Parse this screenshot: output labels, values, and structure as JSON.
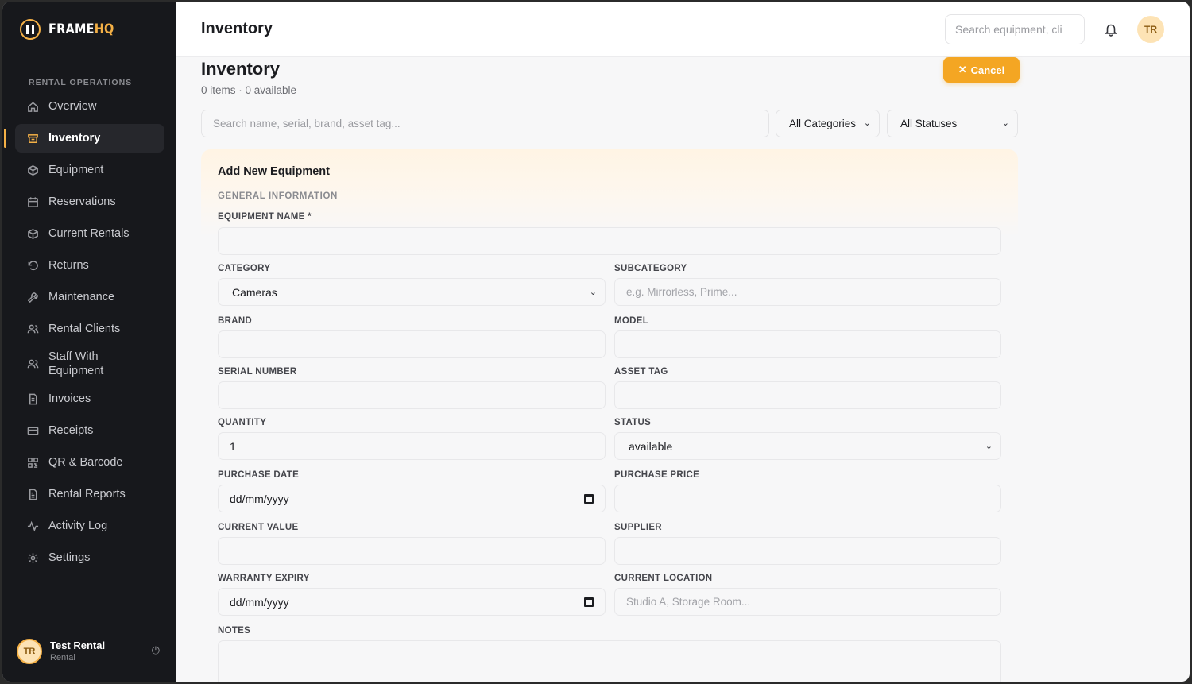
{
  "brand": {
    "name_main": "FRAME",
    "name_accent": "HQ"
  },
  "sidebar": {
    "section_label": "RENTAL OPERATIONS",
    "items": [
      {
        "label": "Overview",
        "icon": "home-icon"
      },
      {
        "label": "Inventory",
        "icon": "archive-icon",
        "active": true
      },
      {
        "label": "Equipment",
        "icon": "box-icon"
      },
      {
        "label": "Reservations",
        "icon": "calendar-icon"
      },
      {
        "label": "Current Rentals",
        "icon": "box-icon"
      },
      {
        "label": "Returns",
        "icon": "rotate-ccw-icon"
      },
      {
        "label": "Maintenance",
        "icon": "wrench-icon"
      },
      {
        "label": "Rental Clients",
        "icon": "users-icon"
      },
      {
        "label": "Staff With Equipment",
        "icon": "users-icon"
      },
      {
        "label": "Invoices",
        "icon": "file-icon"
      },
      {
        "label": "Receipts",
        "icon": "credit-card-icon"
      },
      {
        "label": "QR & Barcode",
        "icon": "qr-icon"
      },
      {
        "label": "Rental Reports",
        "icon": "file-text-icon"
      },
      {
        "label": "Activity Log",
        "icon": "activity-icon"
      },
      {
        "label": "Settings",
        "icon": "gear-icon"
      }
    ],
    "user": {
      "initials": "TR",
      "name": "Test Rental",
      "role": "Rental"
    }
  },
  "topbar": {
    "title": "Inventory",
    "search_placeholder": "Search equipment, cli",
    "avatar_initials": "TR"
  },
  "page": {
    "title": "Inventory",
    "subtitle": "0 items · 0 available",
    "cancel_label": "Cancel"
  },
  "filters": {
    "search_placeholder": "Search name, serial, brand, asset tag...",
    "category_value": "All Categories",
    "status_value": "All Statuses"
  },
  "form": {
    "title": "Add New Equipment",
    "section": "GENERAL INFORMATION",
    "fields": {
      "equipment_name": {
        "label": "EQUIPMENT NAME *",
        "value": ""
      },
      "category": {
        "label": "CATEGORY",
        "value": "Cameras"
      },
      "subcategory": {
        "label": "SUBCATEGORY",
        "placeholder": "e.g. Mirrorless, Prime..."
      },
      "brand": {
        "label": "BRAND",
        "value": ""
      },
      "model": {
        "label": "MODEL",
        "value": ""
      },
      "serial_number": {
        "label": "SERIAL NUMBER",
        "value": ""
      },
      "asset_tag": {
        "label": "ASSET TAG",
        "value": ""
      },
      "quantity": {
        "label": "QUANTITY",
        "value": "1"
      },
      "status": {
        "label": "STATUS",
        "value": "available"
      },
      "purchase_date": {
        "label": "PURCHASE DATE",
        "value": "dd/mm/yyyy"
      },
      "purchase_price": {
        "label": "PURCHASE PRICE",
        "value": ""
      },
      "current_value": {
        "label": "CURRENT VALUE",
        "value": ""
      },
      "supplier": {
        "label": "SUPPLIER",
        "value": ""
      },
      "warranty_expiry": {
        "label": "WARRANTY EXPIRY",
        "value": "dd/mm/yyyy"
      },
      "current_location": {
        "label": "CURRENT LOCATION",
        "placeholder": "Studio A, Storage Room..."
      },
      "notes": {
        "label": "NOTES",
        "value": ""
      }
    }
  },
  "colors": {
    "accent": "#f4a623",
    "sidebar_bg": "#17181c",
    "page_bg": "#f7f7f8"
  }
}
